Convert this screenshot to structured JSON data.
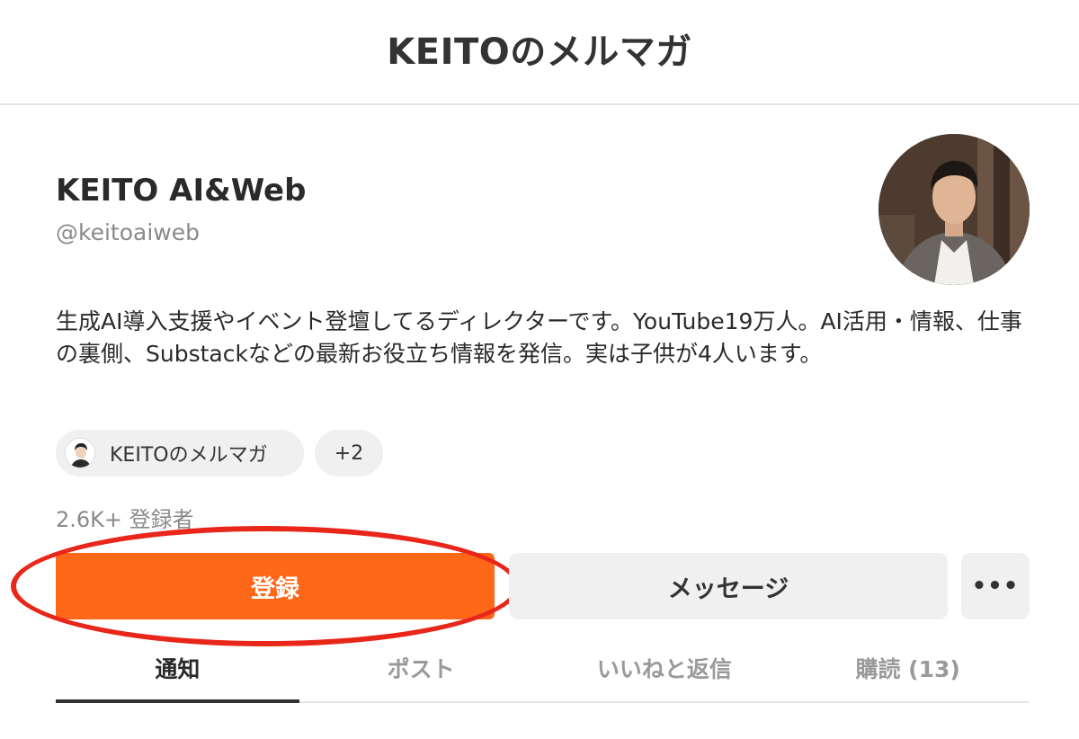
{
  "header": {
    "title": "KEITOのメルマガ"
  },
  "profile": {
    "name": "KEITO AI&Web",
    "handle": "@keitoaiweb",
    "bio": "生成AI導入支援やイベント登壇してるディレクターです。YouTube19万人。AI活用・情報、仕事の裏側、Substackなどの最新お役立ち情報を発信。実は子供が4人います。",
    "avatar_icon": "profile-photo"
  },
  "publications": {
    "chip_label": "KEITOのメルマガ",
    "more_label": "+2"
  },
  "subscribers": {
    "text": "2.6K+ 登録者"
  },
  "actions": {
    "subscribe_label": "登録",
    "message_label": "メッセージ",
    "more_label": "•••"
  },
  "tabs": [
    {
      "label": "通知",
      "active": true
    },
    {
      "label": "ポスト",
      "active": false
    },
    {
      "label": "いいねと返信",
      "active": false
    },
    {
      "label": "購読 (13)",
      "active": false
    }
  ],
  "colors": {
    "accent": "#ff6719",
    "highlight": "#e8261a"
  }
}
